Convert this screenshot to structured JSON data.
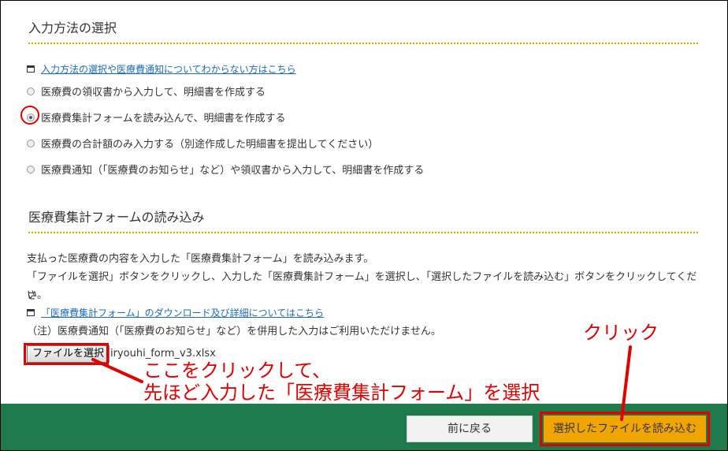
{
  "input_method": {
    "title": "入力方法の選択",
    "help_link": "入力方法の選択や医療費通知についてわからない方はこちら",
    "options": [
      {
        "label": "医療費の領収書から入力して、明細書を作成する",
        "checked": false
      },
      {
        "label": "医療費集計フォームを読み込んで、明細書を作成する",
        "checked": true
      },
      {
        "label": "医療費の合計額のみ入力する（別途作成した明細書を提出してください）",
        "checked": false
      },
      {
        "label": "医療費通知（「医療費のお知らせ」など）や領収書から入力して、明細書を作成する",
        "checked": false
      }
    ]
  },
  "form_load": {
    "title": "医療費集計フォームの読み込み",
    "desc1": "支払った医療費の内容を入力した「医療費集計フォーム」を読み込みます。",
    "desc2": "「ファイルを選択」ボタンをクリックし、入力した「医療費集計フォーム」を選択し、「選択したファイルを読み込む」ボタンをクリックしてくださ",
    "desc3": "い。",
    "download_link": "「医療費集計フォーム」のダウンロード及び詳細についてはこちら",
    "note": "（注）医療費通知（「医療費のお知らせ」など）を併用した入力はご利用いただけません。",
    "file_button": "ファイルを選択",
    "file_name": "iryouhi_form_v3.xlsx"
  },
  "footer": {
    "back_button": "前に戻る",
    "load_button": "選択したファイルを読み込む"
  },
  "annotations": {
    "click_label": "クリック",
    "instruction_line1": "ここをクリックして、",
    "instruction_line2": "先ほど入力した「医療費集計フォーム」を選択"
  },
  "colors": {
    "accent_orange": "#f0a500",
    "footer_green": "#1e7a4a",
    "annotation_red": "#e50000",
    "link_blue": "#1a6bbf"
  }
}
